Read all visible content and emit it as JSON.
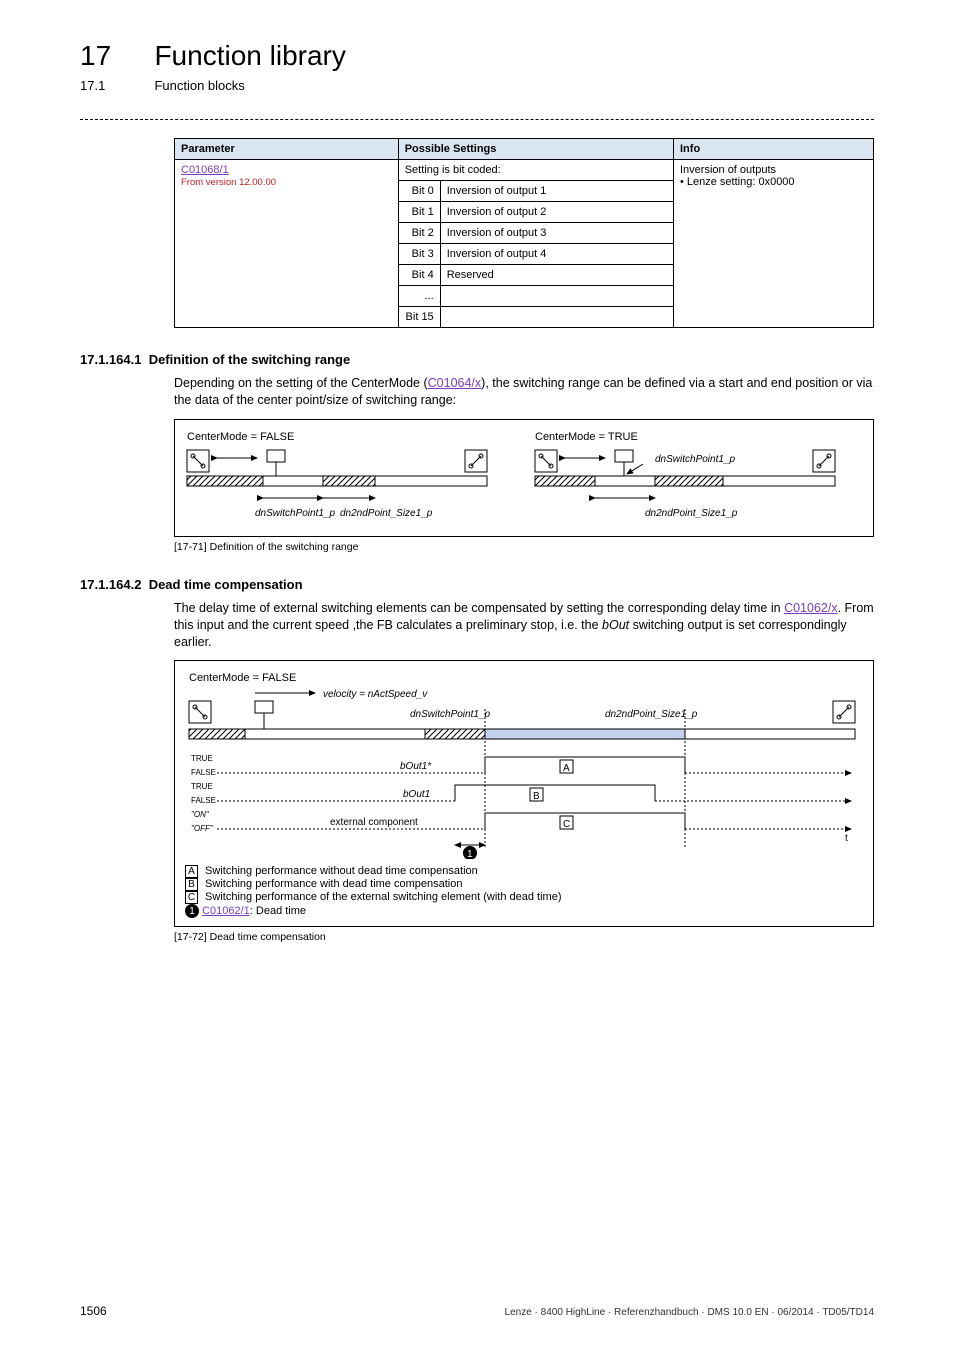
{
  "chapter": {
    "num": "17",
    "title": "Function library"
  },
  "sub": {
    "num": "17.1",
    "title": "Function blocks"
  },
  "table": {
    "headers": {
      "param": "Parameter",
      "settings": "Possible Settings",
      "info": "Info"
    },
    "param_link": "C01068/1",
    "param_note": "From version 12.00.00",
    "setting_head": "Setting is bit coded:",
    "rows": [
      {
        "bit": "Bit 0",
        "text": "Inversion of output 1"
      },
      {
        "bit": "Bit 1",
        "text": "Inversion of output 2"
      },
      {
        "bit": "Bit 2",
        "text": "Inversion of output 3"
      },
      {
        "bit": "Bit 3",
        "text": "Inversion of output 4"
      },
      {
        "bit": "Bit 4",
        "text": "Reserved"
      },
      {
        "bit": "...",
        "text": ""
      },
      {
        "bit": "Bit 15",
        "text": ""
      }
    ],
    "info_lines": [
      "Inversion of outputs",
      "• Lenze setting: 0x0000"
    ]
  },
  "sec1": {
    "num": "17.1.164.1",
    "title": "Definition of the switching range",
    "para_before": "Depending on the setting of the CenterMode (",
    "link": "C01064/x",
    "para_after": "), the switching range can be defined via a start and end position or via the data of the center point/size of switching range:",
    "cm_false": "CenterMode = FALSE",
    "cm_true": "CenterMode = TRUE",
    "lbl_sp1": "dnSwitchPoint1_p",
    "lbl_2nd": "dn2ndPoint_Size1_p",
    "caption": "[17-71] Definition of the switching range"
  },
  "sec2": {
    "num": "17.1.164.2",
    "title": "Dead time compensation",
    "para_pre": "The delay time of external switching elements can be compensated by setting the corresponding delay time in ",
    "link": "C01062/x",
    "para_post1": ". From this input and the current speed ,the FB calculates a preliminary stop, i.e. the ",
    "italic": "bOut",
    "para_post2": " switching output is set correspondingly earlier.",
    "cm_false": "CenterMode = FALSE",
    "velocity_lbl": "velocity = nActSpeed_v",
    "sp1": "dnSwitchPoint1_p",
    "p2": "dn2ndPoint_Size1_p",
    "true": "TRUE",
    "false": "FALSE",
    "on": "\"ON\"",
    "off": "\"OFF\"",
    "bout1star": "bOut1*",
    "bout1": "bOut1",
    "ext": "external component",
    "t": "t",
    "leg_a": " Switching performance without dead time compensation",
    "leg_b": " Switching performance with dead time compensation",
    "leg_c": " Switching performance of the external switching element (with dead time)",
    "leg_d_link": "C01062/1",
    "leg_d_after": ": Dead time",
    "caption": "[17-72] Dead time compensation"
  },
  "footer": {
    "page": "1506",
    "info": "Lenze · 8400 HighLine · Referenzhandbuch · DMS 10.0 EN · 06/2014 · TD05/TD14"
  }
}
